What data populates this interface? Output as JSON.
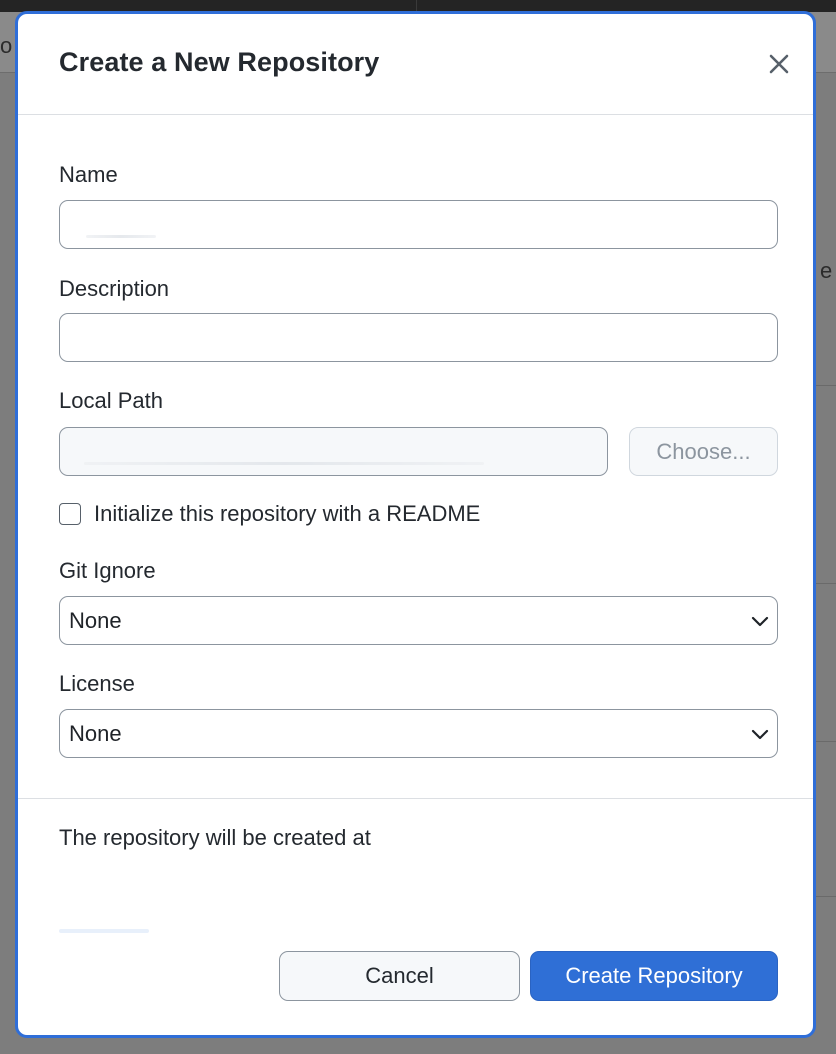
{
  "backdrop": {
    "left_letter": "o",
    "right_letter": "e"
  },
  "modal": {
    "title": "Create a New Repository",
    "close_icon": "close-icon"
  },
  "form": {
    "name": {
      "label": "Name",
      "value": ""
    },
    "description": {
      "label": "Description",
      "value": ""
    },
    "local_path": {
      "label": "Local Path",
      "value": "",
      "choose_label": "Choose..."
    },
    "readme": {
      "label": "Initialize this repository with a README",
      "checked": false
    },
    "gitignore": {
      "label": "Git Ignore",
      "selected": "None"
    },
    "license": {
      "label": "License",
      "selected": "None"
    }
  },
  "summary": {
    "text": "The repository will be created at"
  },
  "actions": {
    "cancel_label": "Cancel",
    "create_label": "Create Repository"
  },
  "colors": {
    "accent": "#2f6fd6",
    "modal_border": "#2f6ed8"
  }
}
